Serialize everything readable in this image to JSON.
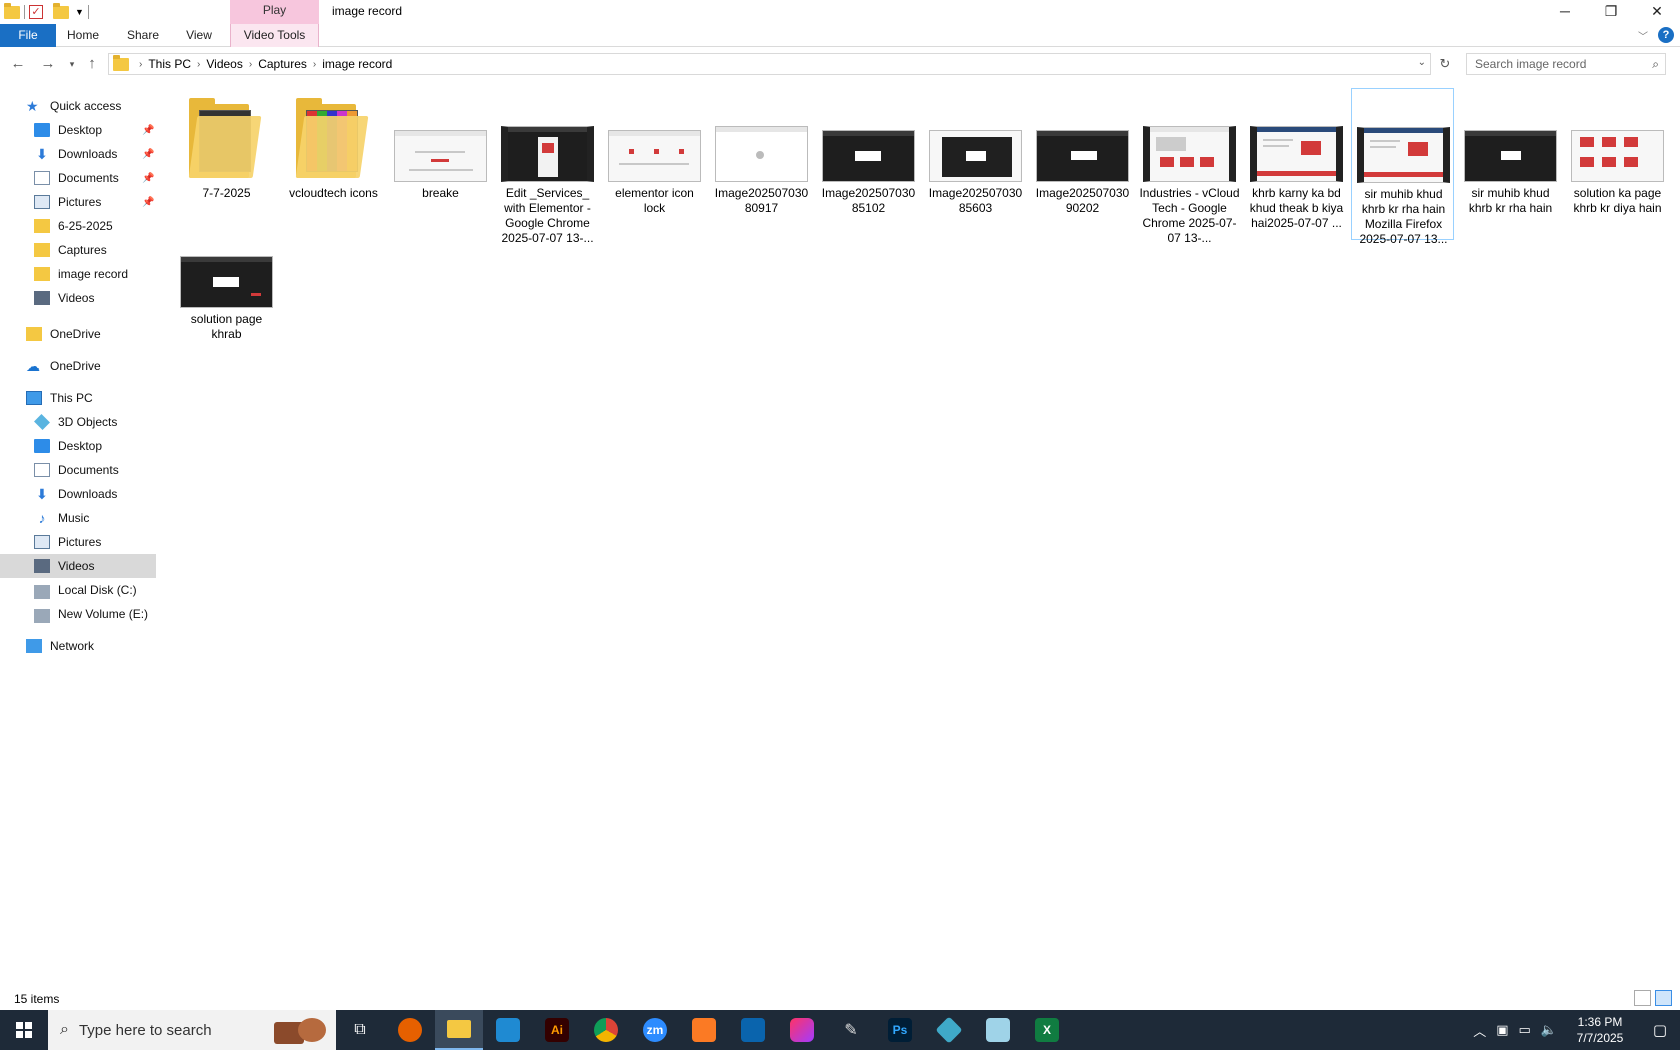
{
  "window": {
    "title": "image record",
    "context_tab": "Play",
    "controls": {
      "minimize": "─",
      "restore": "❐",
      "close": "✕"
    }
  },
  "ribbon": {
    "tabs": [
      "File",
      "Home",
      "Share",
      "View",
      "Video Tools"
    ],
    "help": "?"
  },
  "address": {
    "crumbs": [
      "This PC",
      "Videos",
      "Captures",
      "image record"
    ],
    "search_placeholder": "Search image record"
  },
  "nav": {
    "quick_access": "Quick access",
    "quick_items": [
      "Desktop",
      "Downloads",
      "Documents",
      "Pictures",
      "6-25-2025",
      "Captures",
      "image record",
      "Videos"
    ],
    "onedrive_personal": "OneDrive",
    "onedrive": "OneDrive",
    "this_pc": "This PC",
    "pc_items": [
      "3D Objects",
      "Desktop",
      "Documents",
      "Downloads",
      "Music",
      "Pictures",
      "Videos",
      "Local Disk (C:)",
      "New Volume (E:)"
    ],
    "network": "Network"
  },
  "files": [
    {
      "name": "7-7-2025",
      "kind": "folder"
    },
    {
      "name": "vcloudtech icons",
      "kind": "folder"
    },
    {
      "name": "breake",
      "kind": "image"
    },
    {
      "name": "Edit _Services_ with Elementor - Google Chrome 2025-07-07 13-...",
      "kind": "video"
    },
    {
      "name": "elementor icon lock",
      "kind": "image"
    },
    {
      "name": "Image202507030 80917",
      "kind": "image"
    },
    {
      "name": "Image202507030 85102",
      "kind": "image"
    },
    {
      "name": "Image202507030 85603",
      "kind": "image"
    },
    {
      "name": "Image202507030 90202",
      "kind": "image"
    },
    {
      "name": "Industries - vCloud Tech - Google Chrome 2025-07-07 13-...",
      "kind": "video"
    },
    {
      "name": "khrb karny ka bd khud theak b kiya hai2025-07-07 ...",
      "kind": "video"
    },
    {
      "name": "sir muhib khud khrb kr rha hain Mozilla Firefox 2025-07-07 13...",
      "kind": "video",
      "selected": true
    },
    {
      "name": "sir muhib khud khrb kr rha hain",
      "kind": "image"
    },
    {
      "name": "solution ka page khrb kr diya hain",
      "kind": "image"
    },
    {
      "name": "solution page khrab",
      "kind": "image"
    }
  ],
  "status": {
    "count": "15 items"
  },
  "taskbar": {
    "search_placeholder": "Type here to search",
    "time": "1:36 PM",
    "date": "7/7/2025",
    "apps": [
      "task-view",
      "firefox",
      "file-explorer",
      "vscode",
      "illustrator",
      "chrome",
      "zoom",
      "xampp",
      "outlook",
      "creative-cloud",
      "pen-tool",
      "photoshop",
      "app-blue",
      "app-notepad",
      "excel"
    ],
    "app_glyphs": {
      "illustrator": "Ai",
      "zoom": "zm",
      "photoshop": "Ps",
      "excel": "X"
    }
  },
  "colors": {
    "file_tab": "#1a6fc4",
    "play_context": "#f7c6dd",
    "taskbar": "#1e2a38",
    "selection_border": "#99d1ff"
  }
}
